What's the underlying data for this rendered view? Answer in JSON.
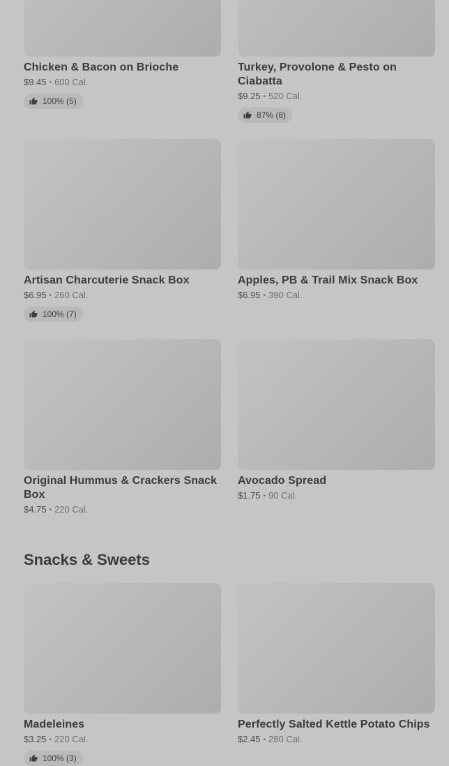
{
  "rows_top": [
    [
      {
        "name": "Chicken & Bacon on Brioche",
        "price": "$9.45",
        "cal": "600 Cal.",
        "rating": "100% (5)"
      },
      {
        "name": "Turkey, Provolone & Pesto on Ciabatta",
        "price": "$9.25",
        "cal": "520 Cal.",
        "rating": "87% (8)"
      }
    ],
    [
      {
        "name": "Artisan Charcuterie Snack Box",
        "price": "$6.95",
        "cal": "260 Cal.",
        "rating": "100% (7)"
      },
      {
        "name": "Apples, PB & Trail Mix Snack Box",
        "price": "$6.95",
        "cal": "390 Cal."
      }
    ],
    [
      {
        "name": "Original Hummus & Crackers Snack Box",
        "price": "$4.75",
        "cal": "220 Cal."
      },
      {
        "name": "Avocado Spread",
        "price": "$1.75",
        "cal": "90 Cal."
      }
    ]
  ],
  "section": {
    "title": "Snacks & Sweets"
  },
  "rows_snacks": [
    [
      {
        "name": "Madeleines",
        "price": "$3.25",
        "cal": "220 Cal.",
        "rating": "100% (3)"
      },
      {
        "name": "Perfectly Salted Kettle Potato Chips",
        "price": "$2.45",
        "cal": "280 Cal."
      }
    ]
  ],
  "separator": "•",
  "icons": {
    "rating": "thumbs-up-icon"
  },
  "colors": {
    "background": "#c5c5c5",
    "thumbnail": "#b7b7b7",
    "rating_pill": "#b9b9b9",
    "text": "#3a3a3a"
  }
}
